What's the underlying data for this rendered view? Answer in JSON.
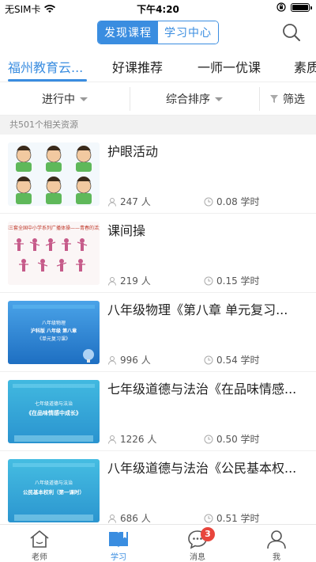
{
  "status": {
    "carrier": "无SIM卡",
    "time": "下午4:20"
  },
  "header": {
    "segments": [
      {
        "label": "发现课程",
        "active": true
      },
      {
        "label": "学习中心",
        "active": false
      }
    ],
    "search_icon": "search-icon"
  },
  "category_tabs": [
    "福州教育云...",
    "好课推荐",
    "一师一优课",
    "素质"
  ],
  "filters": {
    "status_label": "进行中",
    "sort_label": "综合排序",
    "filter_label": "筛选"
  },
  "count_text": "共501个相关资源",
  "items": [
    {
      "title": "护眼活动",
      "people": "247 人",
      "hours": "0.08 学时",
      "thumb": "eye-exercise"
    },
    {
      "title": "课间操",
      "people": "219 人",
      "hours": "0.15 学时",
      "thumb": "exercise",
      "thumb_text": "第三套全国中小学系列广播体操——青春的活力"
    },
    {
      "title": "八年级物理《第八章 单元复习...",
      "people": "996 人",
      "hours": "0.54 学时",
      "thumb": "physics",
      "thumb_text": [
        "八年级物理",
        "沪科版 八年级 第八章",
        "《单元复习课》"
      ]
    },
    {
      "title": "七年级道德与法治《在品味情感...",
      "people": "1226 人",
      "hours": "0.50 学时",
      "thumb": "moral7",
      "thumb_text": [
        "七年级道德与法治",
        "《在品味情感中成长》"
      ]
    },
    {
      "title": "八年级道德与法治《公民基本权...",
      "people": "686 人",
      "hours": "0.51 学时",
      "thumb": "moral8",
      "thumb_text": [
        "八年级道德与法治",
        "公民基本权利（第一课时）"
      ]
    }
  ],
  "tabbar": [
    {
      "label": "老师",
      "icon": "house-icon",
      "active": false
    },
    {
      "label": "学习",
      "icon": "book-icon",
      "active": true
    },
    {
      "label": "消息",
      "icon": "chat-icon",
      "active": false,
      "badge": "3"
    },
    {
      "label": "我",
      "icon": "person-icon",
      "active": false
    }
  ],
  "colors": {
    "accent": "#3a8de0",
    "badge": "#e8453c"
  }
}
